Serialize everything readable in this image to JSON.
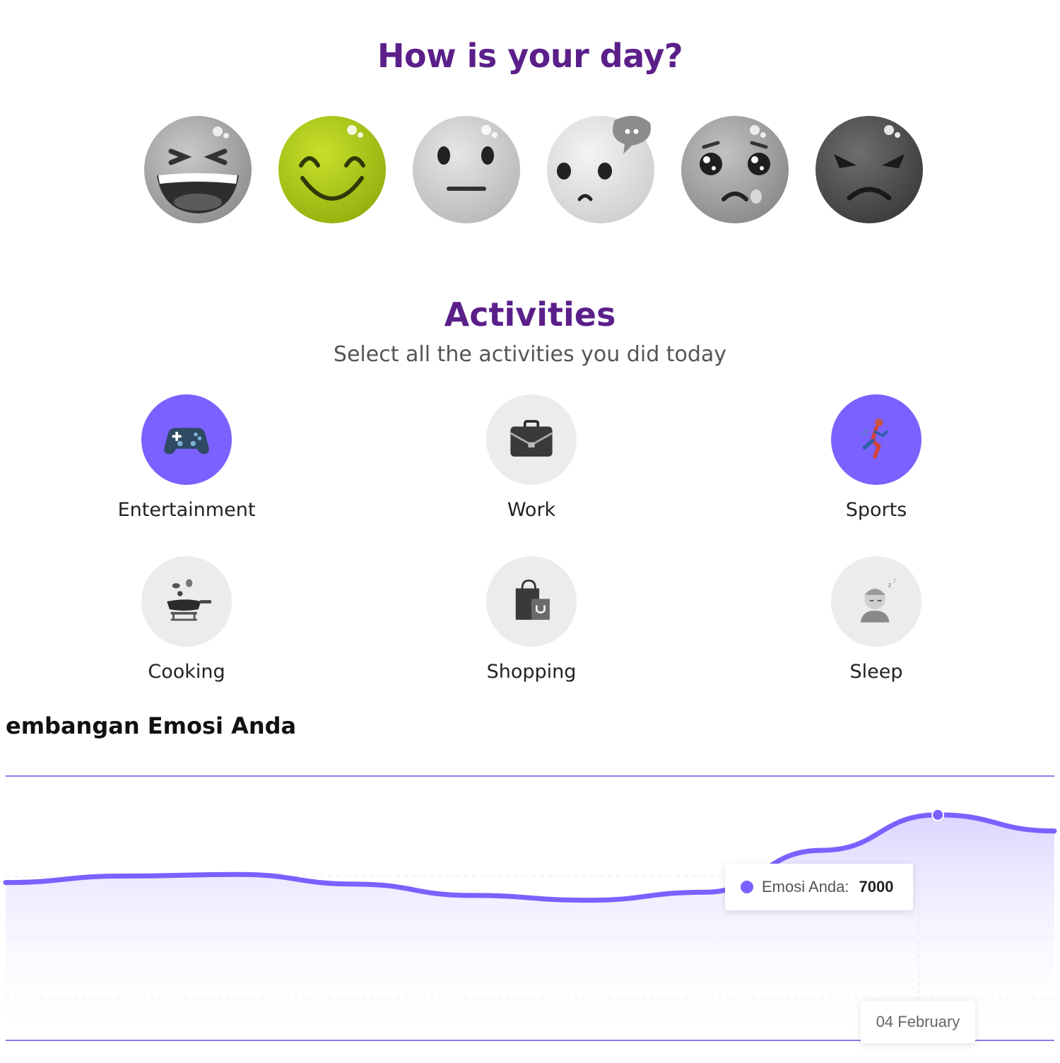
{
  "mood_section": {
    "title": "How is your day?",
    "moods": [
      {
        "name": "laughing",
        "selected": false
      },
      {
        "name": "happy",
        "selected": true
      },
      {
        "name": "neutral",
        "selected": false
      },
      {
        "name": "worried",
        "selected": false
      },
      {
        "name": "sad",
        "selected": false
      },
      {
        "name": "angry",
        "selected": false
      }
    ]
  },
  "activities_section": {
    "title": "Activities",
    "subtitle": "Select all the activities you did today",
    "items": [
      {
        "label": "Entertainment",
        "icon": "gamepad-icon",
        "selected": true
      },
      {
        "label": "Work",
        "icon": "briefcase-icon",
        "selected": false
      },
      {
        "label": "Sports",
        "icon": "runner-icon",
        "selected": true
      },
      {
        "label": "Cooking",
        "icon": "cooking-pan-icon",
        "selected": false
      },
      {
        "label": "Shopping",
        "icon": "shopping-bag-icon",
        "selected": false
      },
      {
        "label": "Sleep",
        "icon": "sleeping-person-icon",
        "selected": false
      }
    ]
  },
  "chart_section": {
    "title": "embangan Emosi Anda"
  },
  "chart_data": {
    "type": "area",
    "series": [
      {
        "name": "Emosi Anda",
        "values": [
          4900,
          5100,
          5150,
          4850,
          4500,
          4350,
          4600,
          5900,
          7000,
          6500
        ]
      }
    ],
    "tooltip": {
      "series": "Emosi Anda:",
      "value": "7000",
      "x": "04 February"
    },
    "grid": true,
    "colors": {
      "line": "#7b61ff",
      "fill": "#d9d0ff"
    }
  }
}
